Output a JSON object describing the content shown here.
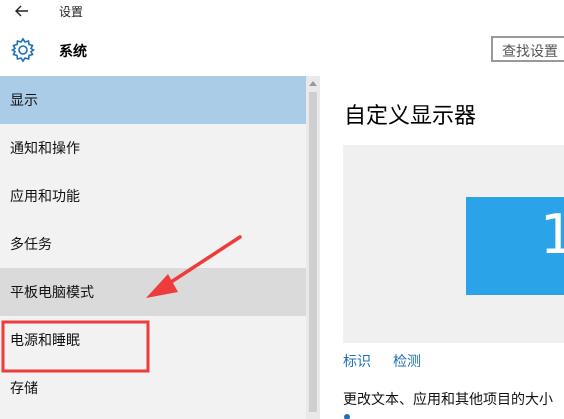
{
  "window": {
    "title": "设置"
  },
  "header": {
    "section_title": "系统",
    "search_placeholder": "查找设置"
  },
  "sidebar": {
    "items": [
      {
        "label": "显示",
        "state": "selected"
      },
      {
        "label": "通知和操作",
        "state": "normal"
      },
      {
        "label": "应用和功能",
        "state": "normal"
      },
      {
        "label": "多任务",
        "state": "normal"
      },
      {
        "label": "平板电脑模式",
        "state": "hover"
      },
      {
        "label": "电源和睡眠",
        "state": "highlighted"
      },
      {
        "label": "存储",
        "state": "normal"
      }
    ]
  },
  "content": {
    "title": "自定义显示器",
    "monitor_number": "1",
    "identify_link": "标识",
    "detect_link": "检测",
    "scale_description": "更改文本、应用和其他项目的大小"
  },
  "colors": {
    "accent": "#1e6fb5",
    "selected_bg": "#aacce6",
    "hover_bg": "#dadada",
    "sidebar_bg": "#f2f2f2",
    "monitor_blue": "#2aa3e8",
    "annotation_red": "#ee3b3b"
  },
  "icons": {
    "back": "back-arrow-icon",
    "settings": "gear-icon"
  }
}
